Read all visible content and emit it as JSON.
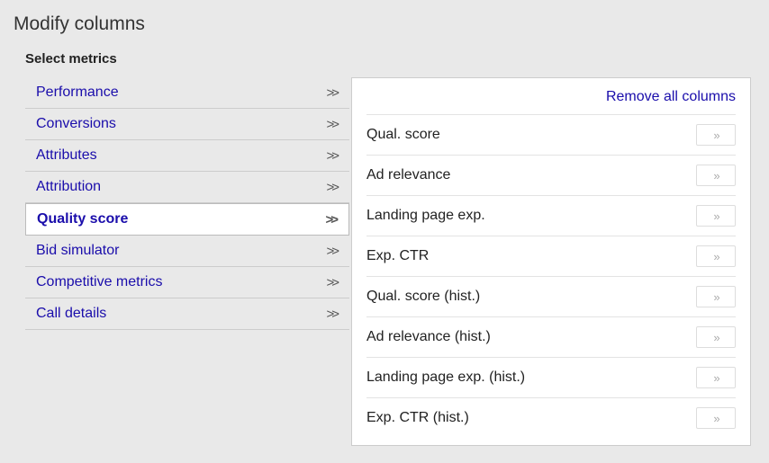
{
  "page_title": "Modify columns",
  "section_title": "Select metrics",
  "sidebar": {
    "items": [
      {
        "label": "Performance",
        "selected": false
      },
      {
        "label": "Conversions",
        "selected": false
      },
      {
        "label": "Attributes",
        "selected": false
      },
      {
        "label": "Attribution",
        "selected": false
      },
      {
        "label": "Quality score",
        "selected": true
      },
      {
        "label": "Bid simulator",
        "selected": false
      },
      {
        "label": "Competitive metrics",
        "selected": false
      },
      {
        "label": "Call details",
        "selected": false
      }
    ]
  },
  "main": {
    "remove_all_label": "Remove all columns",
    "metrics": [
      {
        "label": "Qual. score"
      },
      {
        "label": "Ad relevance"
      },
      {
        "label": "Landing page exp."
      },
      {
        "label": "Exp. CTR"
      },
      {
        "label": "Qual. score (hist.)"
      },
      {
        "label": "Ad relevance (hist.)"
      },
      {
        "label": "Landing page exp. (hist.)"
      },
      {
        "label": "Exp. CTR (hist.)"
      }
    ]
  },
  "glyphs": {
    "chevron_right": ">>",
    "add_icon": "»"
  }
}
